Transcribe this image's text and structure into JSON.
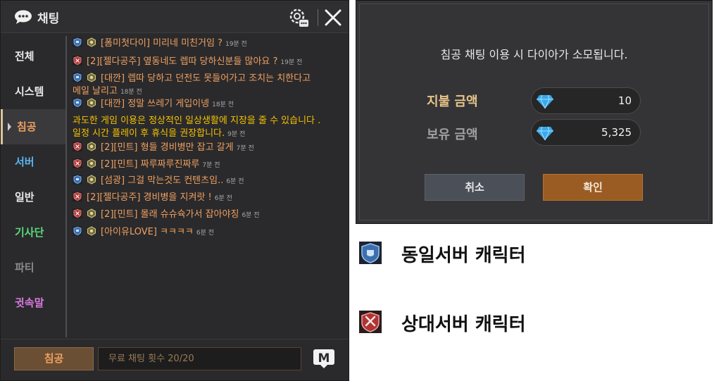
{
  "chat": {
    "title": "채팅",
    "sidebar": [
      {
        "label": "전체",
        "color": "#e8e8e8"
      },
      {
        "label": "시스템",
        "color": "#e8e8e8"
      },
      {
        "label": "침공",
        "color": "#f0a060"
      },
      {
        "label": "서버",
        "color": "#5ab4f0"
      },
      {
        "label": "일반",
        "color": "#e8e8e8"
      },
      {
        "label": "기사단",
        "color": "#5adc7a"
      },
      {
        "label": "파티",
        "color": "#8a8a8a"
      },
      {
        "label": "귓속말",
        "color": "#d87ae0"
      }
    ],
    "messages": [
      {
        "icons": [
          "same-server-icon",
          "rank-icon"
        ],
        "text": "[폼미첫다이] 미리네 미친거임 ?",
        "time": "19분 전"
      },
      {
        "icons": [
          "other-server-icon"
        ],
        "text": "[2][젤다공주] 옆동네도 렙따 당하신분들 많아요 ?",
        "time": "19분 전"
      },
      {
        "icons": [
          "same-server-icon",
          "rank-icon"
        ],
        "text": "[대깐] 렙따 당하고 던전도 못들어가고 조치는 치한다고",
        "text2": "메일 날리고",
        "time": "18분 전"
      },
      {
        "icons": [
          "same-server-icon",
          "rank-icon"
        ],
        "text": "[대깐] 정말 쓰레기 게입이넹",
        "time": "18분 전"
      },
      {
        "icons": [],
        "warn": true,
        "text": "과도한 게임 이용은 정상적인 일상생활에 지장을 줄 수 있습니다 .",
        "text2": "일정 시간 플레이 후 휴식을 권장합니다.",
        "time": "9분 전"
      },
      {
        "icons": [
          "other-server-icon",
          "rank-icon"
        ],
        "text": "[2][민트] 형들 경비병만 잡고 갈게",
        "time": "7분 전"
      },
      {
        "icons": [
          "other-server-icon",
          "rank-icon"
        ],
        "text": "[2][민트] 짜루짜루진짜루",
        "time": "7분 전"
      },
      {
        "icons": [
          "same-server-icon",
          "rank-icon"
        ],
        "text": "[섬광] 그걸 막는것도 컨텐츠임..",
        "time": "6분 전"
      },
      {
        "icons": [
          "other-server-icon"
        ],
        "text": "[2][젤다공주] 경비병을 지켜랏 !",
        "time": "6분 전"
      },
      {
        "icons": [
          "other-server-icon",
          "rank-icon"
        ],
        "text": "[2][민트] 몰래 슈슈슉가서 잡아야징",
        "time": "6분 전"
      },
      {
        "icons": [
          "same-server-icon",
          "rank-icon"
        ],
        "text": "[아이유LOVE] ㅋㅋㅋㅋ",
        "time": "6분 전"
      }
    ],
    "channel_button": "침공",
    "input_text": "무료 채팅 횟수 20/20"
  },
  "dialog": {
    "message": "침공 채팅 이용 시 다이아가 소모됩니다.",
    "pay_label": "지불 금액",
    "pay_value": "10",
    "hold_label": "보유 금액",
    "hold_value": "5,325",
    "cancel_label": "취소",
    "ok_label": "확인"
  },
  "legend": {
    "same_server": "동일서버 캐릭터",
    "other_server": "상대서버 캐릭터"
  }
}
